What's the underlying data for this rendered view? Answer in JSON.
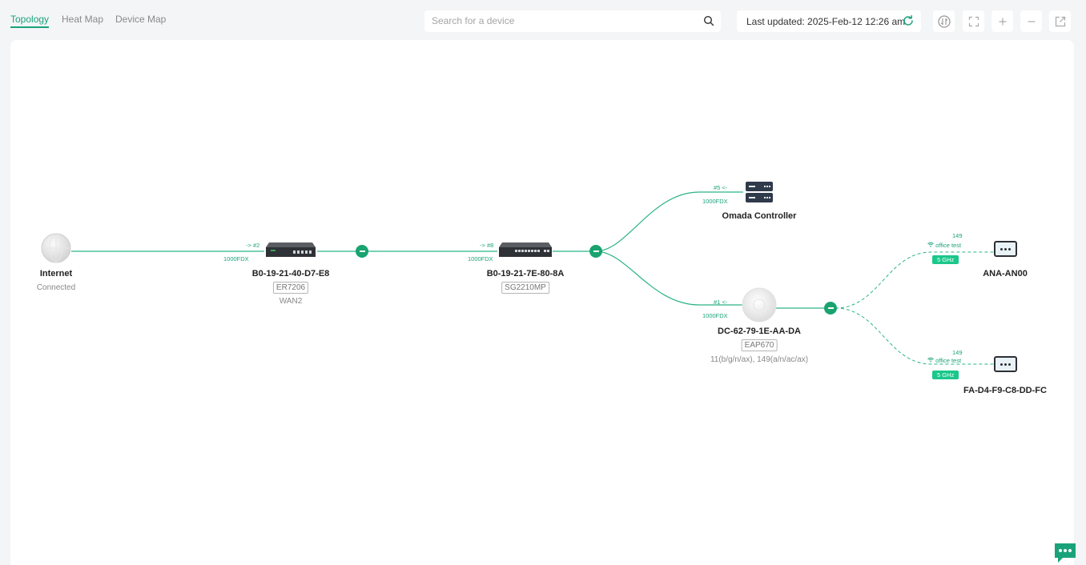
{
  "tabs": [
    {
      "label": "Topology",
      "active": true
    },
    {
      "label": "Heat Map",
      "active": false
    },
    {
      "label": "Device Map",
      "active": false
    }
  ],
  "search": {
    "placeholder": "Search for a device",
    "value": ""
  },
  "last_updated": "Last updated: 2025-Feb-12 12:26 am",
  "toolbar_icons": [
    "network-speed-icon",
    "fullscreen-icon",
    "zoom-in-icon",
    "zoom-out-icon",
    "open-external-icon"
  ],
  "colors": {
    "accent": "#1aa37a",
    "badge": "#1bc78b",
    "link": "#2bb487"
  },
  "nodes": {
    "internet": {
      "name": "Internet",
      "status": "Connected"
    },
    "gateway": {
      "name": "B0-19-21-40-D7-E8",
      "model": "ER7206",
      "extra": "WAN2",
      "port": "-> #2",
      "speed": "1000FDX"
    },
    "switch": {
      "name": "B0-19-21-7E-80-8A",
      "model": "SG2210MP",
      "port": "-> #8",
      "speed": "1000FDX"
    },
    "controller": {
      "name": "Omada Controller",
      "port": "#5 <-",
      "speed": "1000FDX"
    },
    "ap": {
      "name": "DC-62-79-1E-AA-DA",
      "model": "EAP670",
      "channels": "11(b/g/n/ax), 149(a/n/ac/ax)",
      "port": "#1 <-",
      "speed": "1000FDX"
    }
  },
  "clients": [
    {
      "name": "ANA-AN00",
      "channel": "149",
      "ssid": "office test",
      "band": "5 GHz"
    },
    {
      "name": "FA-D4-F9-C8-DD-FC",
      "channel": "149",
      "ssid": "office test",
      "band": "5 GHz"
    }
  ]
}
